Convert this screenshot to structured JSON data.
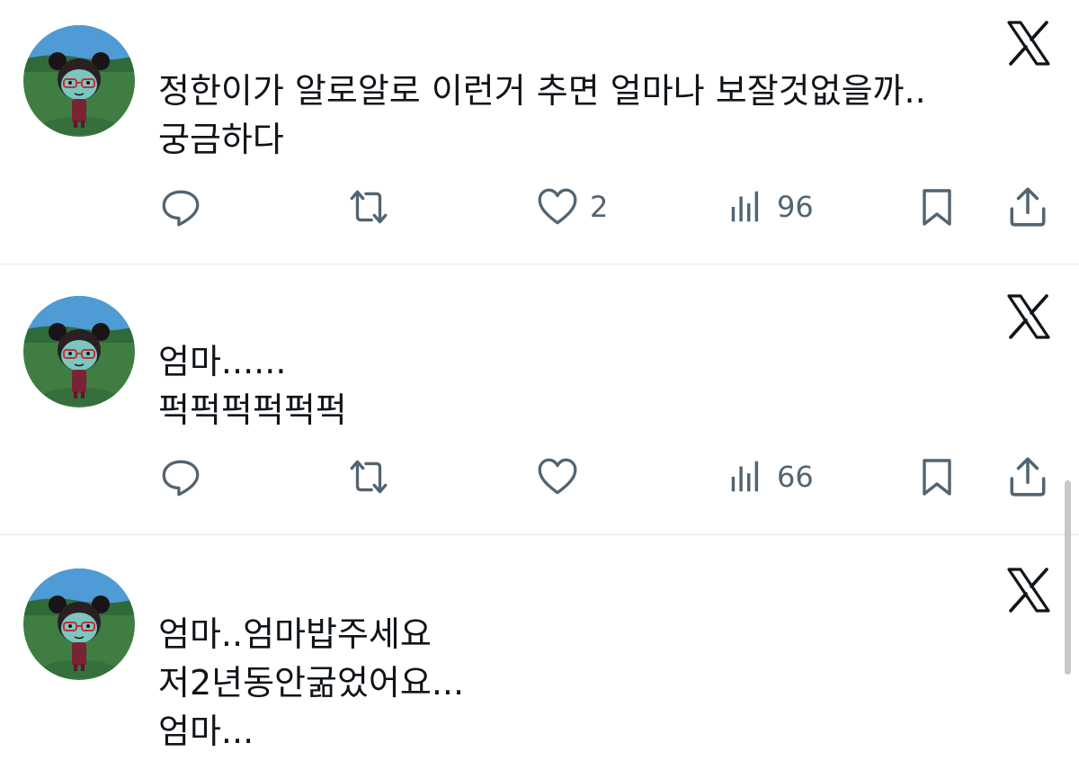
{
  "posts": [
    {
      "text": "정한이가 알로알로 이런거 추면 얼마나 보잘것없을까..\n궁금하다",
      "like_count": "2",
      "view_count": "96"
    },
    {
      "text": "엄마......\n퍽퍽퍽퍽퍽퍽",
      "like_count": "",
      "view_count": "66"
    },
    {
      "text": "엄마..엄마밥주세요\n저2년동안굶었어요...\n엄마...",
      "like_count": "",
      "view_count": ""
    }
  ],
  "icons": {
    "reply": "reply-icon",
    "retweet": "retweet-icon",
    "like": "heart-icon",
    "views": "views-icon",
    "bookmark": "bookmark-icon",
    "share": "share-icon",
    "logo": "x-logo-icon"
  },
  "colors": {
    "text": "#0f1419",
    "icon": "#536471",
    "divider": "#e3e6e8",
    "avatar_sky": "#4f9bd6",
    "avatar_grass": "#3f7d43"
  }
}
